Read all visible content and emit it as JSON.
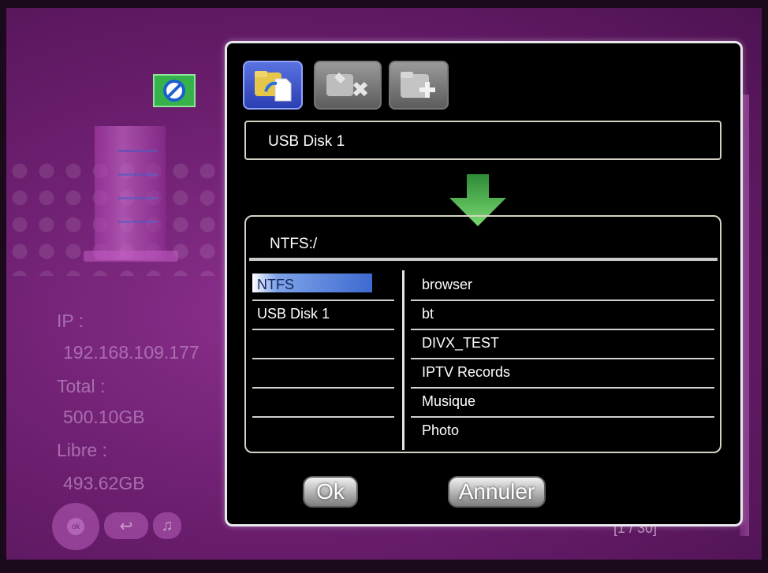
{
  "background": {
    "info": {
      "ip_label": "IP :",
      "ip_value": "192.168.109.177",
      "total_label": "Total :",
      "total_value": "500.10GB",
      "free_label": "Libre :",
      "free_value": "493.62GB"
    },
    "nav_center_label": "ok",
    "page_indicator": "[1 / 30]"
  },
  "dialog": {
    "toolbar": [
      {
        "name": "copy",
        "icon": "copy-files-icon",
        "active": true
      },
      {
        "name": "delete",
        "icon": "delete-files-icon",
        "active": false
      },
      {
        "name": "new-folder",
        "icon": "new-folder-icon",
        "active": false
      }
    ],
    "source": "USB Disk 1",
    "destination_path": "NTFS:/",
    "devices": [
      "NTFS",
      "USB Disk 1",
      "",
      "",
      ""
    ],
    "selected_device": "NTFS",
    "folders": [
      "browser",
      "bt",
      "DIVX_TEST",
      "IPTV Records",
      "Musique",
      "Photo"
    ],
    "ok_label": "Ok",
    "cancel_label": "Annuler"
  },
  "colors": {
    "background": "#6d1f70",
    "selection": "#3e6ad0",
    "arrow": "#3fb54a",
    "active_tool": "#2a3fb3"
  }
}
